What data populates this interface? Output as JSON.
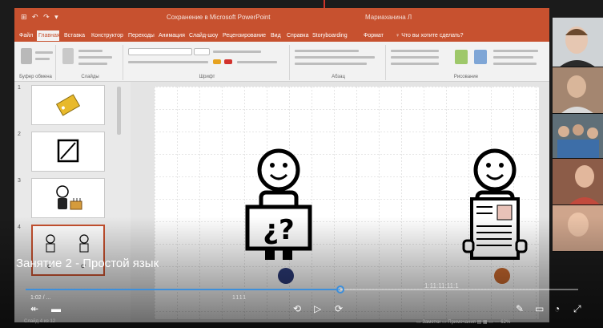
{
  "window": {
    "quick_access": "⊞ ↶ ↷ ▾",
    "title": "Сохранение в Microsoft PowerPoint",
    "user": "Мариаханина Л"
  },
  "ribbon_tabs": [
    {
      "label": "Файл",
      "active": false
    },
    {
      "label": "Главная",
      "active": true
    },
    {
      "label": "Вставка",
      "active": false
    },
    {
      "label": "Конструктор",
      "active": false
    },
    {
      "label": "Переходы",
      "active": false
    },
    {
      "label": "Анимация",
      "active": false
    },
    {
      "label": "Слайд-шоу",
      "active": false
    },
    {
      "label": "Рецензирование",
      "active": false
    },
    {
      "label": "Вид",
      "active": false
    },
    {
      "label": "Справка",
      "active": false
    },
    {
      "label": "Storyboarding",
      "active": false
    },
    {
      "label": "Формат",
      "active": false
    },
    {
      "label": "♀ Что вы хотите сделать?",
      "active": false
    }
  ],
  "ribbon_groups": {
    "clipboard": "Буфер обмена",
    "slides": "Слайды",
    "font": "Шрифт",
    "paragraph": "Абзац",
    "drawing": "Рисование"
  },
  "thumbnails": [
    {
      "number": "1",
      "selected": false,
      "content": "tag"
    },
    {
      "number": "2",
      "selected": false,
      "content": "board"
    },
    {
      "number": "3",
      "selected": false,
      "content": "person-cake"
    },
    {
      "number": "4",
      "selected": true,
      "content": "two-people"
    }
  ],
  "video": {
    "title": "Занятие 2 - Простой язык",
    "progress_fraction": 0.57,
    "time_readout": "1:02 / ...",
    "marker_a": "1111",
    "marker_b": "1:11:11:11:1",
    "status_left": "Слайд 4 из 12",
    "status_right": "▭ Заметки ▭ Примечания ▤ ▦ ▭ — 62%"
  },
  "controls": {
    "prev": "↞",
    "screen": "▬",
    "rewind": "⟲",
    "play": "▷",
    "forward": "⟳",
    "pen": "✎",
    "caption": "▭",
    "volume": "◔",
    "fullscreen": "⤢"
  },
  "colors": {
    "ribbon_accent": "#c7512f",
    "progress": "#3d8fdb",
    "dot_navy": "#2b3a77",
    "dot_orange": "#c9692e"
  }
}
